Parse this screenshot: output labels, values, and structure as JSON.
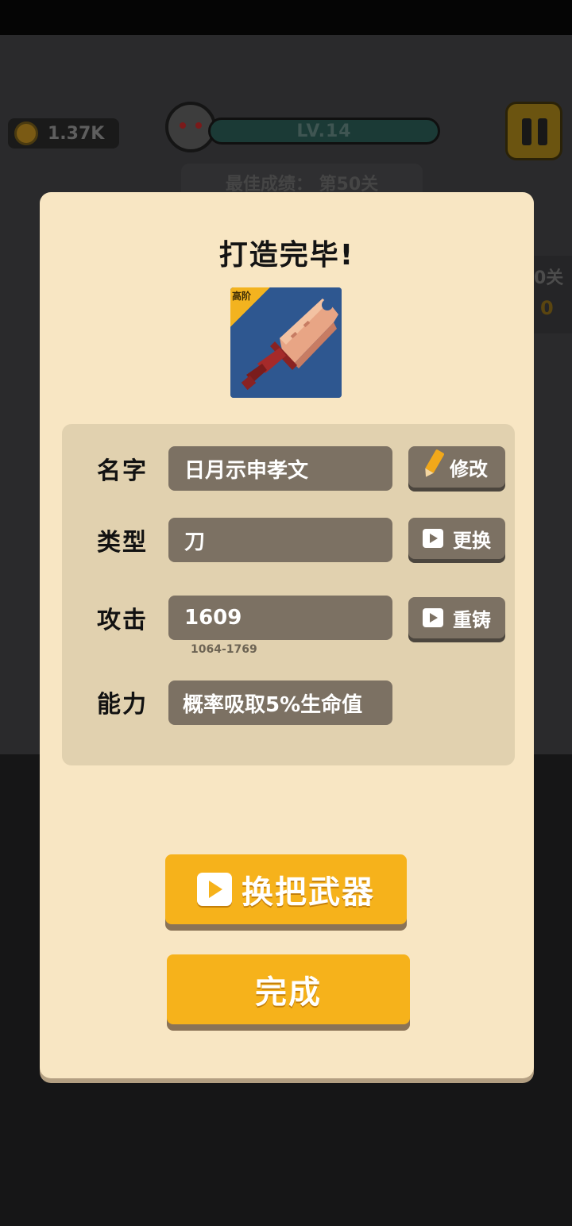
{
  "hud": {
    "coins": "1.37K",
    "level": "LV.14",
    "best_score": "最佳成绩：  第50关",
    "side_stage": "0关",
    "side_number": "0"
  },
  "dialog": {
    "title": "打造完毕!",
    "weapon": {
      "tier_badge": "高阶",
      "icon": "cleaver-sword-icon"
    },
    "rows": {
      "name": {
        "label": "名字",
        "value": "日月示申孝文",
        "button": "修改"
      },
      "type": {
        "label": "类型",
        "value": "刀",
        "button": "更换"
      },
      "attack": {
        "label": "攻击",
        "value": "1609",
        "range": "1064-1769",
        "button": "重铸"
      },
      "ability": {
        "label": "能力",
        "value": "概率吸取5%生命值"
      }
    },
    "swap_weapon_button": "换把武器",
    "done_button": "完成"
  },
  "colors": {
    "dialog_bg": "#f8e6c3",
    "panel_bg": "#e1d1af",
    "value_box": "#7c7163",
    "accent_orange": "#f6b21b",
    "weapon_card_bg": "#2e5790"
  }
}
